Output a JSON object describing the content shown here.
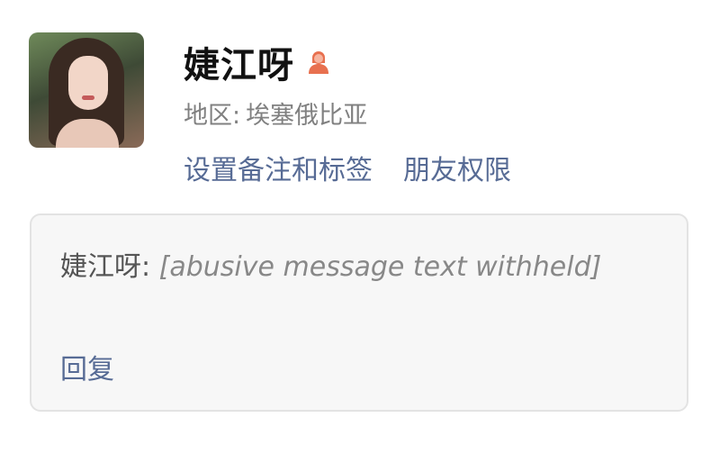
{
  "profile": {
    "name": "婕江呀",
    "gender_icon": "female-person-icon",
    "gender_icon_color": "#e8704f",
    "region_label": "地区:",
    "region_value": "埃塞俄比亚"
  },
  "links": {
    "remark_label": "设置备注和标签",
    "permission_label": "朋友权限"
  },
  "message": {
    "sender_prefix": "婕江呀:",
    "body": "[abusive message text withheld]"
  },
  "reply_label": "回复",
  "colors": {
    "link": "#576b95",
    "card_bg": "#f7f7f7"
  }
}
